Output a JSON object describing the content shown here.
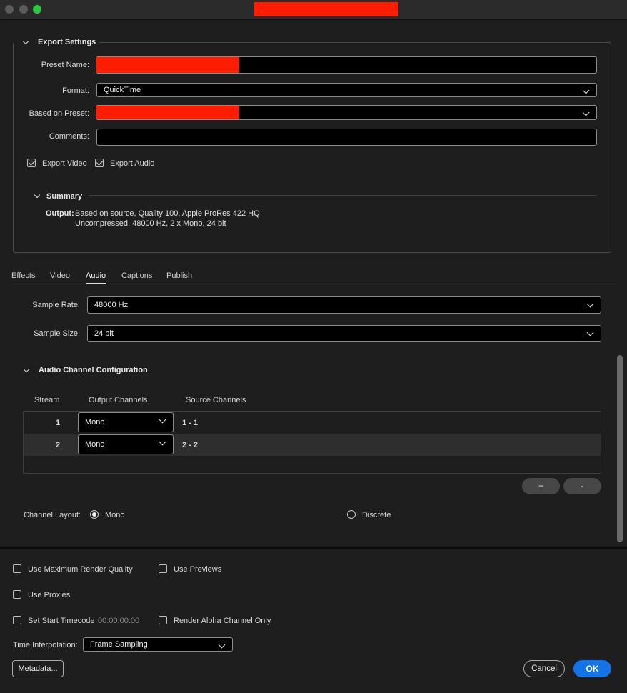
{
  "window": {
    "colors": {
      "close": "#5b5b5b",
      "minimize": "#5b5b5b",
      "zoom": "#2ac840",
      "redaction": "#ff1d00",
      "accent": "#1473e6"
    }
  },
  "export_settings": {
    "title": "Export Settings",
    "preset_name_label": "Preset Name:",
    "format_label": "Format:",
    "format_value": "QuickTime",
    "based_on_preset_label": "Based on Preset:",
    "comments_label": "Comments:",
    "comments_value": "",
    "export_video_label": "Export Video",
    "export_video_checked": true,
    "export_audio_label": "Export Audio",
    "export_audio_checked": true
  },
  "summary": {
    "title": "Summary",
    "output_label": "Output:",
    "output_line1": "Based on source, Quality 100, Apple ProRes 422 HQ",
    "output_line2": "Uncompressed, 48000 Hz, 2 x Mono, 24 bit"
  },
  "tabs": [
    {
      "label": "Effects"
    },
    {
      "label": "Video"
    },
    {
      "label": "Audio",
      "active": true
    },
    {
      "label": "Captions"
    },
    {
      "label": "Publish"
    }
  ],
  "audio": {
    "sample_rate_label": "Sample Rate:",
    "sample_rate_value": "48000 Hz",
    "sample_size_label": "Sample Size:",
    "sample_size_value": "24 bit",
    "channel_config_title": "Audio Channel Configuration",
    "columns": [
      "Stream",
      "Output Channels",
      "Source Channels"
    ],
    "rows": [
      {
        "stream": "1",
        "output": "Mono",
        "source": "1 - 1"
      },
      {
        "stream": "2",
        "output": "Mono",
        "source": "2 - 2"
      }
    ],
    "add_label": "+",
    "remove_label": "-",
    "channel_layout_label": "Channel Layout:",
    "layout_mono": "Mono",
    "layout_discrete": "Discrete",
    "layout_selected": "Mono"
  },
  "render": {
    "max_quality_label": "Use Maximum Render Quality",
    "use_previews_label": "Use Previews",
    "use_proxies_label": "Use Proxies",
    "start_timecode_label": "Set Start Timecode",
    "start_timecode_value": "00:00:00:00",
    "alpha_only_label": "Render Alpha Channel Only",
    "time_interp_label": "Time Interpolation:",
    "time_interp_value": "Frame Sampling"
  },
  "footer": {
    "metadata_label": "Metadata...",
    "cancel_label": "Cancel",
    "ok_label": "OK"
  }
}
